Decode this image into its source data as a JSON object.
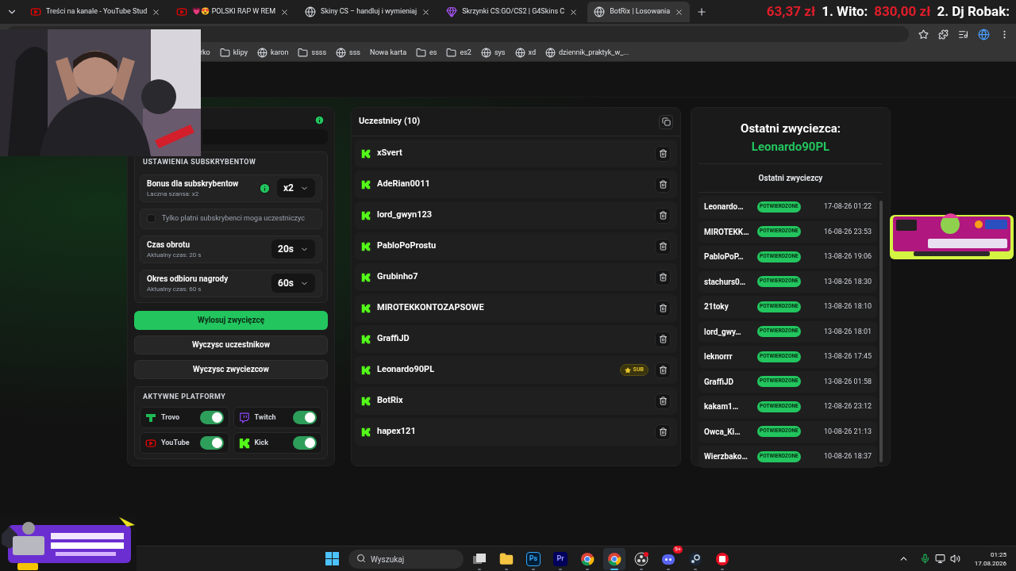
{
  "browser": {
    "tabs": [
      {
        "title": "Treści na kanale - YouTube Stud",
        "kind": "youtube",
        "selected": false
      },
      {
        "title": "💗😍 POLSKI RAP W REM",
        "kind": "youtube",
        "selected": false
      },
      {
        "title": "Skiny CS – handluj i wymieniaj",
        "kind": "site",
        "selected": false
      },
      {
        "title": "Skrzynki CS:GO/CS2 | G4Skins C",
        "kind": "gem",
        "selected": false
      },
      {
        "title": "BotRix | Losowania",
        "kind": "site",
        "selected": true
      }
    ],
    "ticker": [
      {
        "text": "63,37 zł",
        "kind": "amount"
      },
      {
        "text": "1. Wito:",
        "kind": "name"
      },
      {
        "text": "830,00 zł",
        "kind": "amount"
      },
      {
        "text": "2. Dj Robak:",
        "kind": "name"
      }
    ],
    "bookmarks": [
      {
        "label": "rko",
        "kind": "none"
      },
      {
        "label": "klipy",
        "kind": "folder"
      },
      {
        "label": "karon",
        "kind": "site"
      },
      {
        "label": "ssss",
        "kind": "folder"
      },
      {
        "label": "sss",
        "kind": "site"
      },
      {
        "label": "Nowa karta",
        "kind": "none"
      },
      {
        "label": "es",
        "kind": "folder"
      },
      {
        "label": "es2",
        "kind": "folder"
      },
      {
        "label": "sys",
        "kind": "site"
      },
      {
        "label": "xd",
        "kind": "site"
      },
      {
        "label": "dziennik_praktyk_w_...",
        "kind": "site"
      }
    ]
  },
  "settings": {
    "section": "USTAWIENIA SUBSKRYBENTOW",
    "rows": [
      {
        "kind": "select",
        "title": "Bonus dla subskrybentow",
        "subtitle": "Laczna szansa: x2",
        "value": "x2",
        "info": true
      },
      {
        "kind": "checkbox",
        "label": "Tylko platni subskrybenci moga uczestniczyc",
        "checked": false
      },
      {
        "kind": "select",
        "title": "Czas obrotu",
        "subtitle": "Aktualny czas: 20 s",
        "value": "20s",
        "info": false
      },
      {
        "kind": "select",
        "title": "Okres odbioru nagrody",
        "subtitle": "Aktualny czas: 60 s",
        "value": "60s",
        "info": false
      }
    ],
    "buttons": [
      {
        "label": "Wylosuj zwycięzcę",
        "kind": "primary"
      },
      {
        "label": "Wyczysc uczestnikow",
        "kind": "secondary"
      },
      {
        "label": "Wyczysc zwyciezcow",
        "kind": "secondary"
      }
    ],
    "platforms_title": "AKTYWNE PLATFORMY",
    "platforms": [
      {
        "name": "Trovo",
        "kind": "trovo",
        "on": true
      },
      {
        "name": "Twitch",
        "kind": "twitch",
        "on": true
      },
      {
        "name": "YouTube",
        "kind": "youtube",
        "on": true
      },
      {
        "name": "Kick",
        "kind": "kick",
        "on": true
      }
    ]
  },
  "participants": {
    "title": "Uczestnicy (10)",
    "items": [
      {
        "name": "xSvert"
      },
      {
        "name": "AdeRian0011"
      },
      {
        "name": "lord_gwyn123"
      },
      {
        "name": "PabloPoProstu"
      },
      {
        "name": "Grubinho7"
      },
      {
        "name": "MIROTEKKONTOZAPSOWE"
      },
      {
        "name": "GraffiJD"
      },
      {
        "name": "Leonardo90PL",
        "badge": "SUB"
      },
      {
        "name": "BotRix"
      },
      {
        "name": "hapex121"
      }
    ]
  },
  "winners": {
    "heading": "Ostatni zwyciezca:",
    "last_winner": "Leonardo90PL",
    "list_title": "Ostatni zwyciezcy",
    "items": [
      {
        "name": "Leonardo…",
        "status": "POTWIERDZONE",
        "date": "17-08-26 01:22"
      },
      {
        "name": "MIROTEKK…",
        "status": "POTWIERDZONE",
        "date": "16-08-26 23:53"
      },
      {
        "name": "PabloPoP…",
        "status": "POTWIERDZONE",
        "date": "13-08-26 19:06"
      },
      {
        "name": "stachurs0…",
        "status": "POTWIERDZONE",
        "date": "13-08-26 18:30"
      },
      {
        "name": "21toky",
        "status": "POTWIERDZONE",
        "date": "13-08-26 18:10"
      },
      {
        "name": "lord_gwy…",
        "status": "POTWIERDZONE",
        "date": "13-08-26 18:01"
      },
      {
        "name": "leknorrr",
        "status": "POTWIERDZONE",
        "date": "13-08-26 17:45"
      },
      {
        "name": "GraffiJD",
        "status": "POTWIERDZONE",
        "date": "13-08-26 01:58"
      },
      {
        "name": "kakam1…",
        "status": "POTWIERDZONE",
        "date": "12-08-26 23:12"
      },
      {
        "name": "Owca_Ki…",
        "status": "POTWIERDZONE",
        "date": "10-08-26 21:13"
      },
      {
        "name": "Wierzbako…",
        "status": "POTWIERDZONE",
        "date": "10-08-26 18:37"
      }
    ]
  },
  "taskbar": {
    "search_placeholder": "Wyszukaj",
    "apps": [
      {
        "kind": "taskview",
        "selected": false
      },
      {
        "kind": "folder",
        "selected": false
      },
      {
        "kind": "ps",
        "label": "Ps",
        "selected": false
      },
      {
        "kind": "pr",
        "label": "Pr",
        "selected": false
      },
      {
        "kind": "chrome",
        "selected": false
      },
      {
        "kind": "chrome",
        "selected": true
      },
      {
        "kind": "obs",
        "selected": false
      },
      {
        "kind": "discord",
        "badge": "9+",
        "selected": false
      },
      {
        "kind": "steam",
        "selected": false
      },
      {
        "kind": "red",
        "selected": false
      }
    ],
    "time": "01:25",
    "date": "17.08.2026"
  }
}
